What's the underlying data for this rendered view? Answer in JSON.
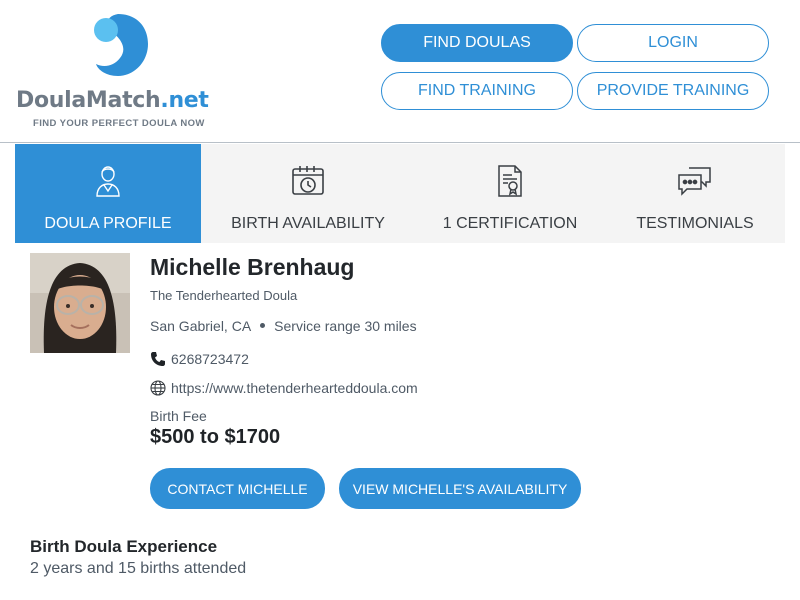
{
  "brand": {
    "name_main": "DoulaMatch",
    "name_ext": ".net",
    "tagline": "FIND YOUR PERFECT DOULA NOW",
    "colors": {
      "accent": "#2f8fd6",
      "logo_light": "#5bc0f0",
      "logo_gray": "#6f7a86"
    }
  },
  "nav": {
    "find_doulas": "FIND DOULAS",
    "login": "LOGIN",
    "find_training": "FIND TRAINING",
    "provide_training": "PROVIDE TRAINING"
  },
  "tabs": [
    {
      "label": "DOULA PROFILE",
      "icon": "doula-person-icon",
      "active": true
    },
    {
      "label": "BIRTH AVAILABILITY",
      "icon": "calendar-clock-icon",
      "active": false
    },
    {
      "label": "1 CERTIFICATION",
      "icon": "certificate-icon",
      "active": false
    },
    {
      "label": "TESTIMONIALS",
      "icon": "chat-bubbles-icon",
      "active": false
    }
  ],
  "profile": {
    "name": "Michelle Brenhaug",
    "business": "The Tenderhearted Doula",
    "location": "San Gabriel, CA",
    "service_range": "Service range 30 miles",
    "phone": "6268723472",
    "website": "https://www.thetenderhearteddoula.com",
    "fee_label": "Birth Fee",
    "fee": "$500 to $1700"
  },
  "actions": {
    "contact": "CONTACT MICHELLE",
    "availability": "VIEW MICHELLE'S AVAILABILITY"
  },
  "experience": {
    "title": "Birth Doula Experience",
    "text": "2 years and 15 births attended"
  }
}
